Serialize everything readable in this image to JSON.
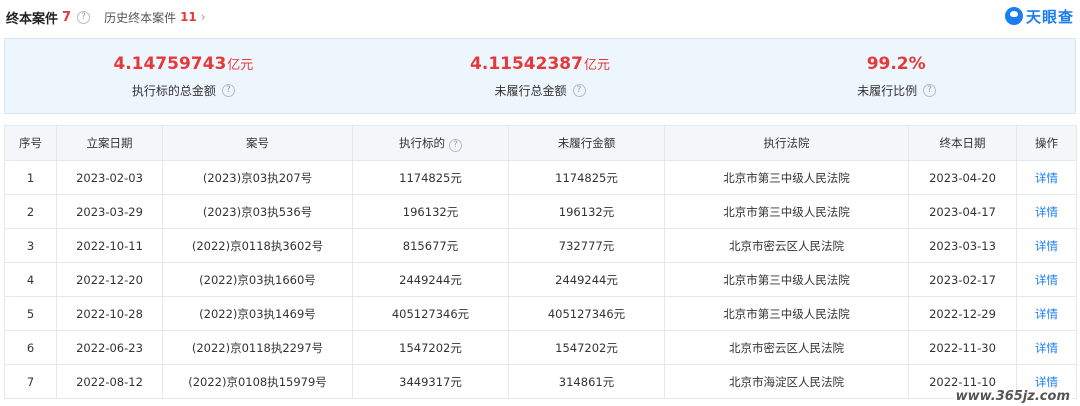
{
  "header": {
    "tab_main_label": "终本案件",
    "tab_main_count": "7",
    "tab_hist_label": "历史终本案件",
    "tab_hist_count": "11",
    "logo_text": "天眼查"
  },
  "summary": [
    {
      "value": "4.14759743",
      "unit": "亿元",
      "label": "执行标的总金额"
    },
    {
      "value": "4.11542387",
      "unit": "亿元",
      "label": "未履行总金额"
    },
    {
      "value": "99.2%",
      "unit": "",
      "label": "未履行比例"
    }
  ],
  "table": {
    "headers": [
      "序号",
      "立案日期",
      "案号",
      "执行标的",
      "未履行金额",
      "执行法院",
      "终本日期",
      "操作"
    ],
    "rows": [
      [
        "1",
        "2023-02-03",
        "(2023)京03执207号",
        "1174825元",
        "1174825元",
        "北京市第三中级人民法院",
        "2023-04-20",
        "详情"
      ],
      [
        "2",
        "2023-03-29",
        "(2023)京03执536号",
        "196132元",
        "196132元",
        "北京市第三中级人民法院",
        "2023-04-17",
        "详情"
      ],
      [
        "3",
        "2022-10-11",
        "(2022)京0118执3602号",
        "815677元",
        "732777元",
        "北京市密云区人民法院",
        "2023-03-13",
        "详情"
      ],
      [
        "4",
        "2022-12-20",
        "(2022)京03执1660号",
        "2449244元",
        "2449244元",
        "北京市第三中级人民法院",
        "2023-02-17",
        "详情"
      ],
      [
        "5",
        "2022-10-28",
        "(2022)京03执1469号",
        "405127346元",
        "405127346元",
        "北京市第三中级人民法院",
        "2022-12-29",
        "详情"
      ],
      [
        "6",
        "2022-06-23",
        "(2022)京0118执2297号",
        "1547202元",
        "1547202元",
        "北京市密云区人民法院",
        "2022-11-30",
        "详情"
      ],
      [
        "7",
        "2022-08-12",
        "(2022)京0108执15979号",
        "3449317元",
        "314861元",
        "北京市海淀区人民法院",
        "2022-11-10",
        "详情"
      ]
    ]
  },
  "watermark": "www.365jz.com"
}
